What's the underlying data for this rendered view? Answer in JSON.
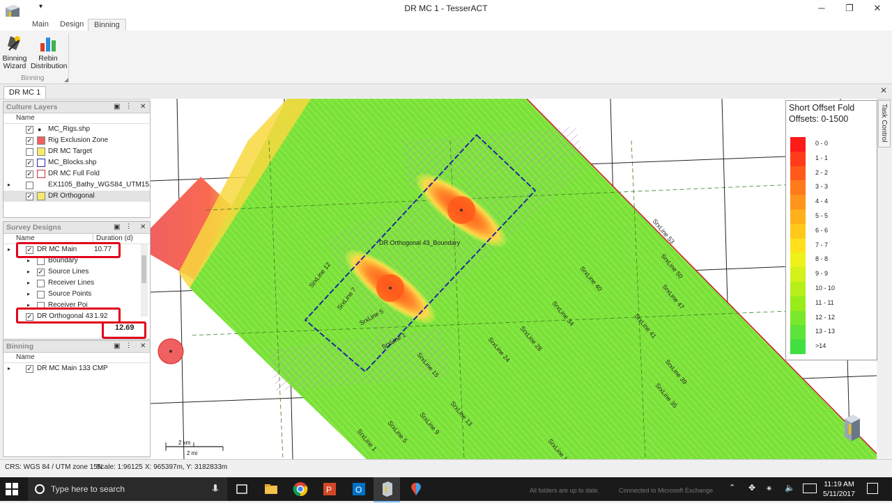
{
  "window": {
    "title": "DR MC 1 - TesserACT",
    "qat_arrow": "▾",
    "minimize": "─",
    "maximize": "❐",
    "close": "✕"
  },
  "ribbon": {
    "tabs": [
      "Main",
      "Design",
      "Binning"
    ],
    "active_tab": "Binning",
    "buttons": [
      {
        "label_line1": "Binning",
        "label_line2": "Wizard",
        "icon": "binning-wizard-icon"
      },
      {
        "label_line1": "Rebin",
        "label_line2": "Distribution",
        "icon": "rebin-distribution-icon"
      }
    ],
    "group": "Binning"
  },
  "document_tab": "DR MC 1",
  "culture_layers": {
    "title": "Culture Layers",
    "column": "Name",
    "items": [
      {
        "name": "MC_Rigs.shp",
        "checked": true,
        "swatch": "dot"
      },
      {
        "name": "Rig Exclusion Zone",
        "checked": true,
        "swatch": "#f06060"
      },
      {
        "name": "DR MC Target",
        "checked": false,
        "swatch": "#f7e96a"
      },
      {
        "name": "MC_Blocks.shp",
        "checked": true,
        "swatch": "#ffffff"
      },
      {
        "name": "DR MC Full Fold",
        "checked": true,
        "swatch": "#ffffff"
      },
      {
        "name": "EX1105_Bathy_WGS84_UTM15...",
        "checked": false,
        "swatch": "none"
      },
      {
        "name": "DR Orthogonal",
        "checked": true,
        "swatch": "#f7e96a"
      }
    ]
  },
  "survey_designs": {
    "title": "Survey Designs",
    "col_name": "Name",
    "col_duration": "Duration (d)",
    "rows": [
      {
        "name": "DR MC Main",
        "duration": "10.77",
        "checked": true
      },
      {
        "name": "Boundary",
        "checked": false
      },
      {
        "name": "Source Lines",
        "checked": true
      },
      {
        "name": "Receiver Lines",
        "checked": false
      },
      {
        "name": "Source Points",
        "checked": false
      },
      {
        "name": "Receiver Poi",
        "checked": false
      },
      {
        "name": "DR Orthogonal 43",
        "duration": "1.92",
        "checked": true
      }
    ],
    "total": "12.69"
  },
  "binning": {
    "title": "Binning",
    "column": "Name",
    "items": [
      {
        "name": "DR MC Main 133 CMP",
        "checked": true
      }
    ]
  },
  "map": {
    "boundary_label": "DR Orthogonal 43_Boundary",
    "line_labels": [
      "SrxLine 53",
      "SrxLine 50",
      "SrxLine 47",
      "SrxLine 41",
      "SrxLine 40",
      "SrxLine 39",
      "SrxLine 35",
      "SrxLine 34",
      "SrxLine 28",
      "SrxLine 24",
      "SrxLine 15",
      "SrxLine 13",
      "SrxLine 12",
      "SrxLine 9",
      "SrxLine 7",
      "SrxLine 5",
      "SrxLine 5",
      "SrxLine 1",
      "SrxLine 1",
      "SrxLine 1"
    ],
    "scale_km": "2 km",
    "scale_mi": "2 mi"
  },
  "legend": {
    "title": "Short Offset Fold",
    "subtitle": "Offsets: 0-1500",
    "entries": [
      {
        "label": "0 - 0",
        "color": "#ff1a1a"
      },
      {
        "label": "1 - 1",
        "color": "#ff3b1a"
      },
      {
        "label": "2 - 2",
        "color": "#ff5a1a"
      },
      {
        "label": "3 - 3",
        "color": "#ff7a1a"
      },
      {
        "label": "4 - 4",
        "color": "#ff951a"
      },
      {
        "label": "5 - 5",
        "color": "#ffb01a"
      },
      {
        "label": "6 - 6",
        "color": "#ffc81a"
      },
      {
        "label": "7 - 7",
        "color": "#ffe01a"
      },
      {
        "label": "8 - 8",
        "color": "#eef21a"
      },
      {
        "label": "9 - 9",
        "color": "#d2f21a"
      },
      {
        "label": "10 - 10",
        "color": "#b6ef1a"
      },
      {
        "label": "11 - 11",
        "color": "#98ec1a"
      },
      {
        "label": "12 - 12",
        "color": "#7ae82a"
      },
      {
        "label": "13 - 13",
        "color": "#5ce43a"
      },
      {
        "label": ">14",
        "color": "#3fe03f"
      }
    ]
  },
  "task_control": "Task Control",
  "status": {
    "crs": "CRS: WGS 84 / UTM zone 15N",
    "scale": "Scale: 1:96125",
    "coords": "X: 965397m, Y: 3182833m"
  },
  "taskbar": {
    "search_placeholder": "Type here to search",
    "notice_left": "All folders are up to date.",
    "notice_right": "Connected to Microsoft Exchange",
    "time": "11:19 AM",
    "date": "5/11/2017"
  }
}
